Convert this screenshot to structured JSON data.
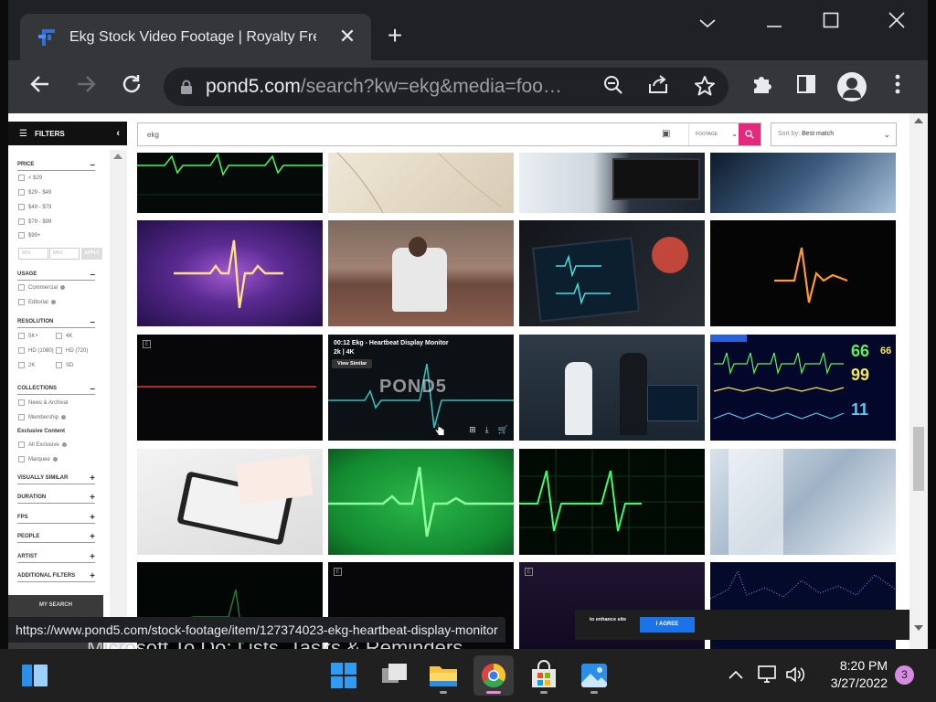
{
  "browser": {
    "tab_title": "Ekg Stock Video Footage | Royalty Free",
    "url_host": "pond5.com",
    "url_rest": "/search?kw=ekg&media=foo…",
    "status_url": "https://www.pond5.com/stock-footage/item/127374023-ekg-heartbeat-display-monitor",
    "background_window_text": "Microsoft To Do: Lists, Tasks & Reminders"
  },
  "sidebar": {
    "header": "FILTERS",
    "sections": {
      "price": "PRICE",
      "usage": "USAGE",
      "resolution": "RESOLUTION",
      "collections": "COLLECTIONS",
      "exclusive": "Exclusive Content",
      "visually_similar": "VISUALLY SIMILAR",
      "duration": "DURATION",
      "fps": "FPS",
      "people": "PEOPLE",
      "artist": "ARTIST",
      "additional": "ADDITIONAL FILTERS"
    },
    "price_options": [
      "< $29",
      "$29 - $49",
      "$49 - $79",
      "$79 - $99",
      "$99+"
    ],
    "min_placeholder": "MIN",
    "max_placeholder": "MAX",
    "apply": "APPLY",
    "usage_options": [
      "Commercial",
      "Editorial"
    ],
    "resolution_options": [
      "5K+",
      "4K",
      "HD (1080)",
      "HD (720)",
      "2K",
      "SD"
    ],
    "collection_options": [
      "News & Archival",
      "Membership"
    ],
    "exclusive_options": [
      "All Exclusive",
      "Marquee"
    ],
    "my_search": "MY SEARCH"
  },
  "search": {
    "query": "ekg",
    "media": "FOOTAGE",
    "sort_label": "Sort by:",
    "sort_value": "Best match"
  },
  "hover_item": {
    "meta": "00:12  Ekg - Heartbeat Display Monitor",
    "res": "2k | 4K",
    "view_similar": "View Similar",
    "watermark": "POND5"
  },
  "vitals": {
    "v1": "66",
    "v2": "66",
    "v3": "99",
    "v4": "11"
  },
  "badge_e": "E",
  "cookie": {
    "text": "to enhance site",
    "agree": "I AGREE"
  },
  "taskbar": {
    "time": "8:20 PM",
    "date": "3/27/2022",
    "notifications": "3"
  },
  "colors": {
    "accent": "#e6287d",
    "ekg_green": "#39ff6a",
    "agree_blue": "#1a73e8"
  }
}
